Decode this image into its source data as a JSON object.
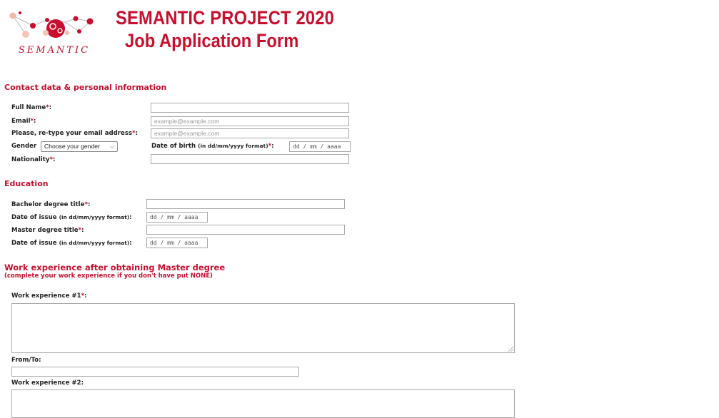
{
  "header": {
    "logo_text": "SEMANTIC",
    "title_line1": "SEMANTIC PROJECT 2020",
    "title_line2": "Job Application Form"
  },
  "colors": {
    "accent": "#c8102e",
    "required": "#d0021b"
  },
  "sections": {
    "contact": "Contact data & personal information",
    "education": "Education",
    "work": "Work experience after obtaining Master degree",
    "work_note": "(complete your work experience if you don't have put NONE)"
  },
  "contact": {
    "full_name_label": "Full Name",
    "email_label": "Email",
    "email_placeholder": "example@example.com",
    "retype_label": "Please, re-type your email address",
    "retype_placeholder": "example@example.com",
    "gender_label": "Gender",
    "gender_selected": "Choose your gender",
    "dob_label": "Date of birth",
    "dob_format": "(in dd/mm/yyyy format)",
    "dob_placeholder": "dd / mm / aaaa",
    "nationality_label": "Nationality"
  },
  "education": {
    "bachelor_label": "Bachelor degree title",
    "issue_label": "Date of issue",
    "issue_format": "(in dd/mm/yyyy format)",
    "date_placeholder": "dd / mm / aaaa",
    "master_label": "Master degree title"
  },
  "work": {
    "exp1_label": "Work experience #1",
    "fromto_label": "From/To:",
    "exp2_label": "Work experience #2:"
  },
  "required_mark": "*",
  "colon": ":"
}
